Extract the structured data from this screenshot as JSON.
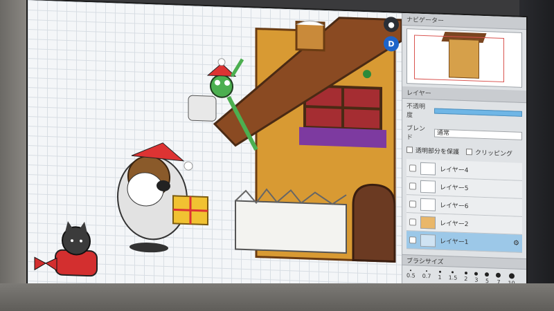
{
  "panel": {
    "navigator_title": "ナビゲーター",
    "layer_title": "レイヤー",
    "opacity_label": "不透明度",
    "blend_label": "ブレンド",
    "blend_value": "通常",
    "lock_alpha_label": "透明部分を保護",
    "clipping_label": "クリッピング",
    "layers": [
      {
        "name": "レイヤー4",
        "active": false
      },
      {
        "name": "レイヤー5",
        "active": false
      },
      {
        "name": "レイヤー6",
        "active": false
      },
      {
        "name": "レイヤー2",
        "active": false
      },
      {
        "name": "レイヤー1",
        "active": true
      }
    ],
    "brush_title": "ブラシサイズ",
    "brush_sizes": [
      "0.5",
      "0.7",
      "1",
      "1.5",
      "2",
      "3",
      "5",
      "7",
      "10"
    ]
  },
  "canvas": {
    "tool_button_blue": "D"
  },
  "colors": {
    "accent": "#1d64c9",
    "active_layer": "#9cc8e8",
    "house_wall": "#d89a33",
    "roof": "#7a4520"
  }
}
